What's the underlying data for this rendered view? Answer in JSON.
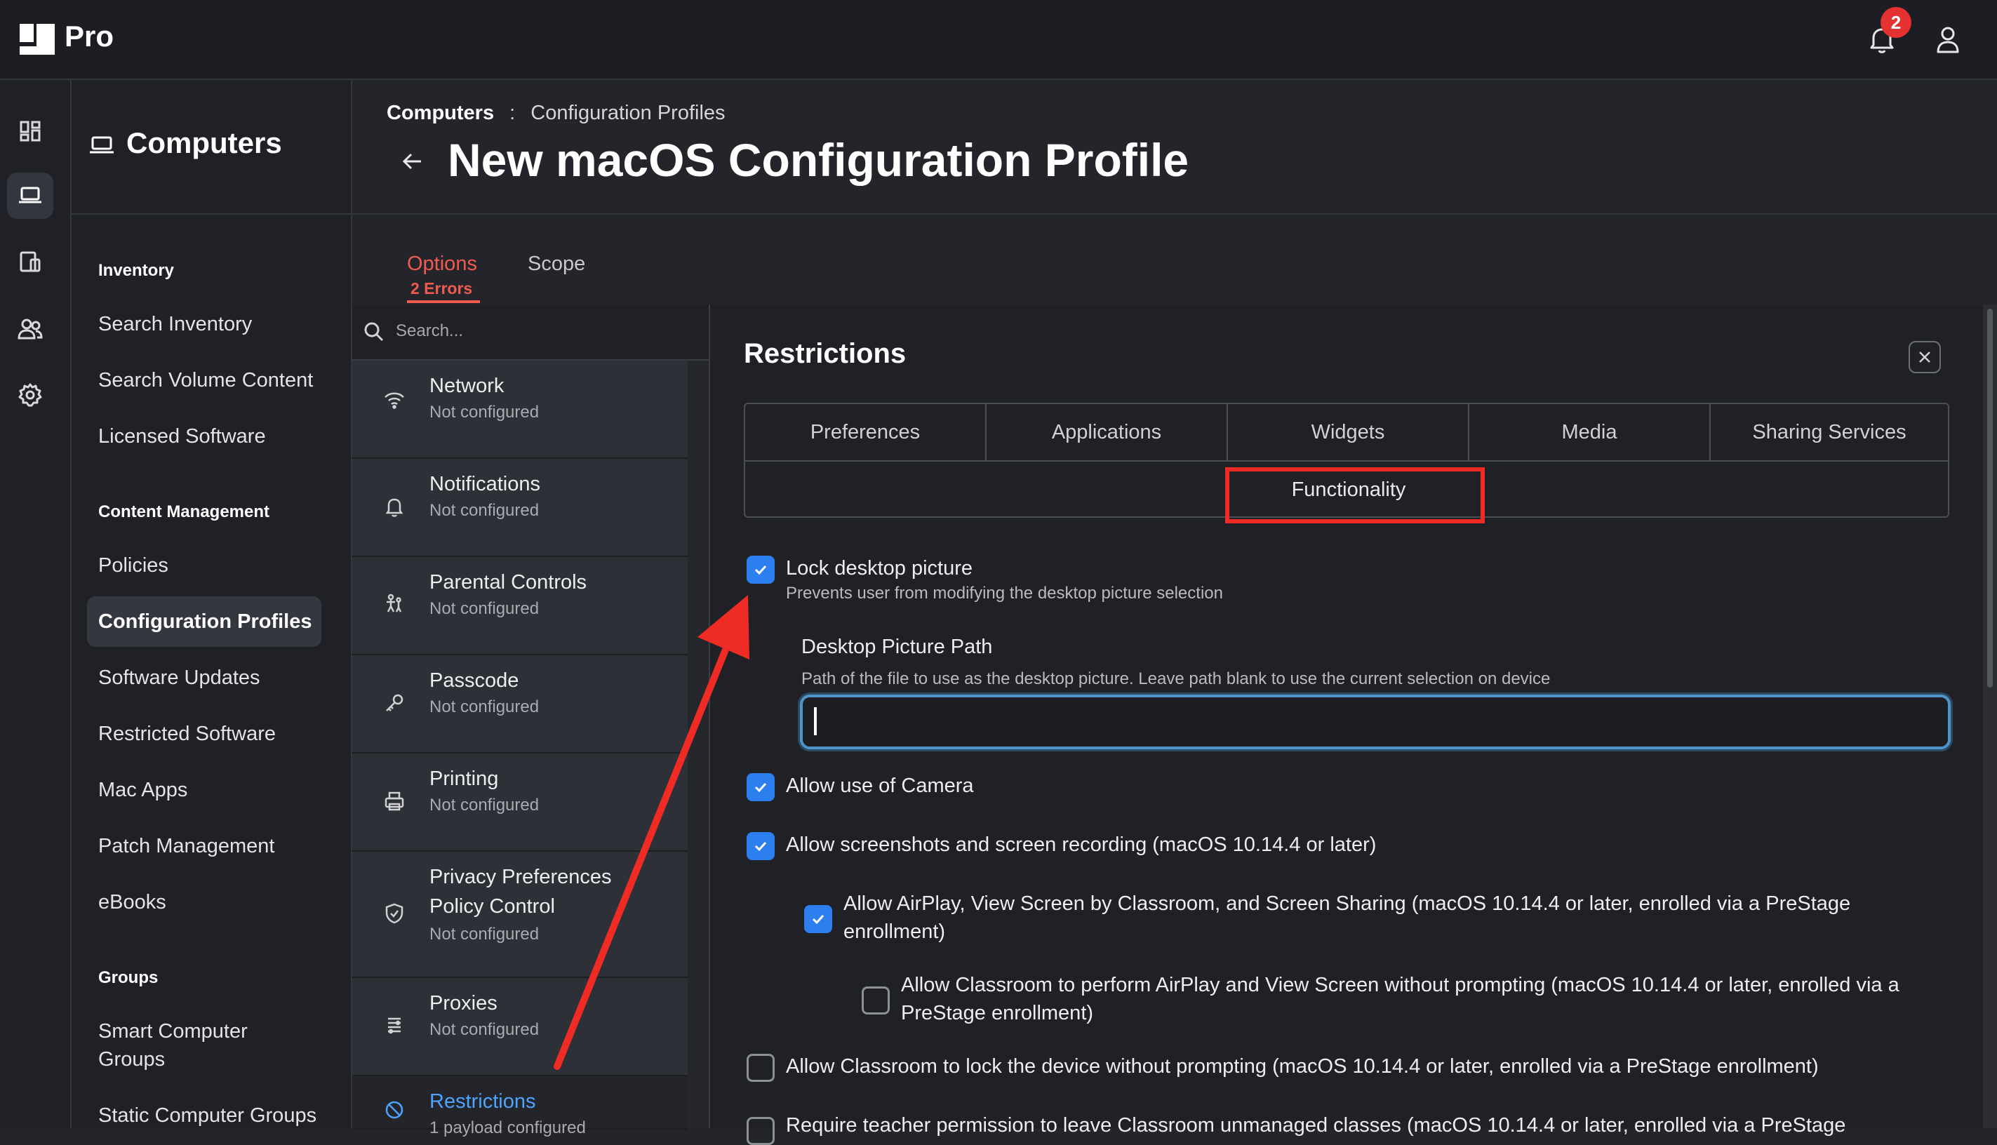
{
  "app": {
    "logo_text": "Pro",
    "notification_count": "2"
  },
  "nav": {
    "title": "Computers",
    "sections": [
      {
        "label": "Inventory",
        "items": [
          "Search Inventory",
          "Search Volume Content",
          "Licensed Software"
        ]
      },
      {
        "label": "Content Management",
        "items": [
          "Policies",
          "Configuration Profiles",
          "Software Updates",
          "Restricted Software",
          "Mac Apps",
          "Patch Management",
          "eBooks"
        ]
      },
      {
        "label": "Groups",
        "items": [
          "Smart Computer Groups",
          "Static Computer Groups"
        ]
      }
    ],
    "active_item": "Configuration Profiles"
  },
  "header": {
    "breadcrumb_root": "Computers",
    "breadcrumb_sep": ":",
    "breadcrumb_current": "Configuration Profiles",
    "title": "New macOS Configuration Profile"
  },
  "tabs": {
    "options": "Options",
    "options_errors": "2 Errors",
    "scope": "Scope"
  },
  "payloads": {
    "search_placeholder": "Search...",
    "items": [
      {
        "name": "Network",
        "status": "Not configured",
        "icon": "wifi-icon"
      },
      {
        "name": "Notifications",
        "status": "Not configured",
        "icon": "bell-icon"
      },
      {
        "name": "Parental Controls",
        "status": "Not configured",
        "icon": "family-icon"
      },
      {
        "name": "Passcode",
        "status": "Not configured",
        "icon": "key-icon"
      },
      {
        "name": "Printing",
        "status": "Not configured",
        "icon": "printer-icon"
      },
      {
        "name": "Privacy Preferences",
        "name2": "Policy Control",
        "status": "Not configured",
        "icon": "shield-icon"
      },
      {
        "name": "Proxies",
        "status": "Not configured",
        "icon": "proxy-icon"
      },
      {
        "name": "Restrictions",
        "status": "1 payload configured",
        "icon": "restricted-icon"
      }
    ]
  },
  "restrictions": {
    "title": "Restrictions",
    "segments": [
      "Preferences",
      "Applications",
      "Widgets",
      "Media",
      "Sharing Services"
    ],
    "active_segment": "Functionality",
    "lock_desktop": {
      "label": "Lock desktop picture",
      "description": "Prevents user from modifying the desktop picture selection",
      "checked": true
    },
    "desktop_path": {
      "label": "Desktop Picture Path",
      "help": "Path of the file to use as the desktop picture. Leave path blank to use the current selection on device",
      "value": ""
    },
    "options": [
      {
        "label": "Allow use of Camera",
        "checked": true
      },
      {
        "label": "Allow screenshots and screen recording (macOS 10.14.4 or later)",
        "checked": true
      },
      {
        "label": "Allow AirPlay, View Screen by Classroom, and Screen Sharing (macOS 10.14.4 or later, enrolled via a PreStage",
        "label_line2": "enrollment)",
        "checked": true
      },
      {
        "label": "Allow Classroom to perform AirPlay and View Screen without prompting (macOS 10.14.4 or later, enrolled via a",
        "label_line2": "PreStage enrollment)",
        "checked": false
      },
      {
        "label": "Allow Classroom to lock the device without prompting (macOS 10.14.4 or later, enrolled via a PreStage enrollment)",
        "checked": false
      },
      {
        "label": "Require teacher permission to leave Classroom unmanaged classes (macOS 10.14.4 or later, enrolled via a PreStage",
        "checked": false
      }
    ]
  },
  "colors": {
    "accent": "#2d7ff0",
    "error": "#f05b50",
    "annotation": "#ee2b24",
    "link": "#4da3ff"
  }
}
